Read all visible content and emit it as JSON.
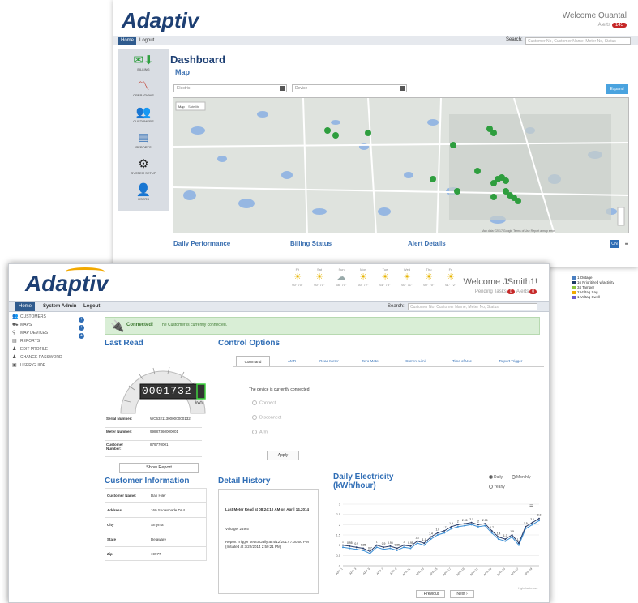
{
  "back_window": {
    "logo": "Adaptiv",
    "welcome": "Welcome Quantal",
    "alerts_label": "Alerts",
    "alerts_count": "145",
    "nav": {
      "home": "Home",
      "logout": "Logout"
    },
    "search_label": "Search:",
    "search_placeholder": "Customer No, Customer Name, Meter No, Status",
    "sidebar": [
      {
        "label": "BILLING",
        "icon": "money-download-icon"
      },
      {
        "label": "OPERATIONS",
        "icon": "line-chart-icon"
      },
      {
        "label": "CUSTOMERS",
        "icon": "users-download-icon"
      },
      {
        "label": "REPORTS",
        "icon": "document-icon"
      },
      {
        "label": "SYSTEM SETUP",
        "icon": "gear-icon"
      },
      {
        "label": "USERS",
        "icon": "user-download-icon"
      }
    ],
    "dashboard_title": "Dashboard",
    "map_label": "Map",
    "select_electric": "Electric",
    "select_device": "Device",
    "expand_label": "Expand",
    "map_tabs": [
      "Map",
      "Satellite"
    ],
    "map_footer": "Map data ©2017 Google   Terms of Use   Report a map error",
    "bottom_sections": [
      "Daily Performance",
      "Billing Status",
      "Alert Details"
    ],
    "on_label": "ON"
  },
  "legend": [
    {
      "label": "1 Outage",
      "color": "#4a7fc1"
    },
    {
      "label": "16 Prioritized w/activity",
      "color": "#1f3b66"
    },
    {
      "label": "34 Tamper",
      "color": "#8dc63f"
    },
    {
      "label": "2 Voltag Sag",
      "color": "#f2a900"
    },
    {
      "label": "1 Voltag Swell",
      "color": "#6a5acd"
    }
  ],
  "front_window": {
    "logo": "Adaptiv",
    "welcome": "Welcome JSmith1!",
    "pending_label": "Pending Tasks",
    "pending_count": "0",
    "alerts_label": "Alerts",
    "alerts_count": "0",
    "weather": [
      {
        "day": "Fri",
        "temp": "60° 70°"
      },
      {
        "day": "Sat",
        "temp": "60° 71°"
      },
      {
        "day": "Sun",
        "temp": "58° 70°"
      },
      {
        "day": "Mon",
        "temp": "60° 72°"
      },
      {
        "day": "Tue",
        "temp": "61° 73°"
      },
      {
        "day": "Wed",
        "temp": "60° 71°"
      },
      {
        "day": "Thu",
        "temp": "60° 70°"
      },
      {
        "day": "Fri",
        "temp": "61° 72°"
      }
    ],
    "nav": {
      "home": "Home",
      "system_admin": "System Admin",
      "logout": "Logout"
    },
    "search_label": "Search:",
    "search_placeholder": "Customer No, Customer Name, Meter No, Status",
    "sidebar": [
      {
        "label": "CUSTOMERS",
        "icon": "users-icon",
        "expandable": true
      },
      {
        "label": "MAPS",
        "icon": "map-icon",
        "expandable": true
      },
      {
        "label": "MAP DEVICES",
        "icon": "pin-icon",
        "expandable": true
      },
      {
        "label": "REPORTS",
        "icon": "document-icon",
        "expandable": false
      },
      {
        "label": "EDIT PROFILE",
        "icon": "user-icon",
        "expandable": false
      },
      {
        "label": "CHANGE PASSWORD",
        "icon": "user-icon",
        "expandable": false
      },
      {
        "label": "USER GUIDE",
        "icon": "book-icon",
        "expandable": false
      }
    ],
    "connected_title": "Connected!",
    "connected_text": "The Customer is currently connected.",
    "last_read_title": "Last Read",
    "meter_display": "0001732",
    "meter_unit": "kWh",
    "meter_info": [
      {
        "key": "Serial Number:",
        "value": "WC63211300000000132"
      },
      {
        "key": "Meter Number:",
        "value": "99887360000001"
      },
      {
        "key": "Customer Number:",
        "value": "879770001"
      }
    ],
    "show_report": "Show Report",
    "control_title": "Control Options",
    "control_tabs": [
      "Command",
      "AMR",
      "Read Meter",
      "Zero Meter",
      "Current Limit",
      "Time of Use",
      "Report Trigger"
    ],
    "device_status": "The device is currently connected",
    "radio_options": [
      "Connect",
      "Disconnect",
      "Arm"
    ],
    "apply_label": "Apply",
    "customer_info_title": "Customer Information",
    "customer_info": [
      {
        "key": "Customer Name:",
        "value": "Dan Hiler"
      },
      {
        "key": "Address",
        "value": "160 Snowshade Dr 4"
      },
      {
        "key": "City",
        "value": "Smyrna"
      },
      {
        "key": "State",
        "value": "Delaware"
      },
      {
        "key": "Zip",
        "value": "19977"
      }
    ],
    "detail_history_title": "Detail History",
    "detail_heading": "Last Meter Read at 08:24:10 AM on April 14,2014",
    "detail_voltage": "Voltage: 249.5",
    "detail_trigger": "Report Trigger set to Daily at 4/12/2017 7:00:00 PM (Initiated at 3/22/2014 2:59:21 PM)",
    "chart_title_1": "Daily Electricity",
    "chart_title_2": "(kWh/hour)",
    "chart_modes": [
      "Daily",
      "Monthly",
      "Yearly"
    ],
    "prev_label": "‹ Previous",
    "next_label": "Next ›",
    "credits": "Highcharts.com"
  },
  "chart_data": {
    "type": "line",
    "title": "Daily Electricity (kWh/hour)",
    "x": [
      "APR 1",
      "APR 2",
      "APR 3",
      "APR 4",
      "APR 5",
      "APR 6",
      "APR 7",
      "APR 8",
      "APR 9",
      "APR 10",
      "APR 11",
      "APR 12",
      "APR 13",
      "APR 14",
      "APR 15",
      "APR 16",
      "APR 17",
      "APR 18",
      "APR 19",
      "APR 20",
      "APR 21",
      "APR 22",
      "APR 23",
      "APR 24",
      "APR 25",
      "APR 26",
      "APR 27",
      "APR 28",
      "APR 29",
      "APR 30"
    ],
    "x_tick_labels": [
      "APR 1",
      "APR 3",
      "APR 5",
      "APR 7",
      "APR 9",
      "APR 11",
      "APR 13",
      "APR 15",
      "APR 17",
      "APR 19",
      "APR 21",
      "APR 23",
      "APR 25",
      "APR 27",
      "APR 29"
    ],
    "series": [
      {
        "values": [
          0.9,
          0.85,
          0.8,
          0.75,
          0.6,
          0.9,
          0.8,
          0.85,
          0.75,
          0.9,
          0.85,
          1.1,
          1.0,
          1.3,
          1.5,
          1.6,
          1.8,
          1.9,
          1.95,
          2.0,
          1.9,
          1.95,
          1.6,
          1.3,
          1.2,
          1.4,
          1.0,
          1.8,
          2.0,
          2.2
        ]
      },
      {
        "values": [
          1.0,
          0.95,
          0.9,
          0.85,
          0.7,
          1.0,
          0.9,
          0.95,
          0.85,
          1.0,
          0.95,
          1.2,
          1.1,
          1.4,
          1.6,
          1.7,
          1.9,
          2.0,
          2.05,
          2.1,
          2.0,
          2.05,
          1.7,
          1.4,
          1.3,
          1.5,
          1.1,
          1.9,
          2.1,
          2.3
        ]
      }
    ],
    "yticks": [
      0,
      0.5,
      1,
      1.5,
      2,
      2.5,
      3
    ],
    "ylim": [
      0,
      3
    ],
    "colors": [
      "#3b8fd6",
      "#2b3f6b"
    ]
  },
  "colors": {
    "brand": "#1d3f73",
    "accent": "#2f6db5",
    "connected_bg": "#d9eed6",
    "alert_red": "#c62828"
  }
}
